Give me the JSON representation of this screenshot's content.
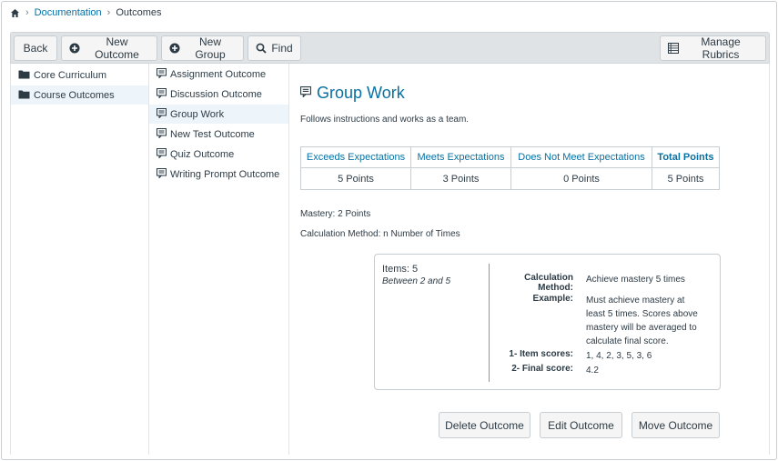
{
  "breadcrumb": {
    "home_icon": "home-icon",
    "items": [
      "Documentation",
      "Outcomes"
    ]
  },
  "toolbar": {
    "back": "Back",
    "new_outcome": "New Outcome",
    "new_group": "New Group",
    "find": "Find",
    "manage_rubrics": "Manage Rubrics"
  },
  "groups": [
    {
      "label": "Core Curriculum",
      "icon": "folder-icon"
    },
    {
      "label": "Course Outcomes",
      "icon": "folder-icon",
      "selected": true
    }
  ],
  "outcomes": [
    {
      "label": "Assignment Outcome",
      "icon": "outcome-icon"
    },
    {
      "label": "Discussion Outcome",
      "icon": "outcome-icon"
    },
    {
      "label": "Group Work",
      "icon": "outcome-icon",
      "selected": true
    },
    {
      "label": "New Test Outcome",
      "icon": "outcome-icon"
    },
    {
      "label": "Quiz Outcome",
      "icon": "outcome-icon"
    },
    {
      "label": "Writing Prompt Outcome",
      "icon": "outcome-icon"
    }
  ],
  "detail": {
    "title": "Group Work",
    "description": "Follows instructions and works as a team.",
    "ratings": [
      {
        "label": "Exceeds Expectations",
        "points": "5 Points"
      },
      {
        "label": "Meets Expectations",
        "points": "3 Points"
      },
      {
        "label": "Does Not Meet Expectations",
        "points": "0 Points"
      }
    ],
    "total": {
      "label": "Total Points",
      "points": "5 Points"
    },
    "mastery": "Mastery: 2 Points",
    "calculation": "Calculation Method: n Number of Times",
    "calc_box": {
      "items_label": "Items:",
      "items_value": "5",
      "between": "Between 2 and 5",
      "method_label": "Calculation Method:",
      "method_value": "Achieve mastery 5 times",
      "example_label": "Example:",
      "example_value": "Must achieve mastery at least 5 times. Scores above mastery will be averaged to calculate final score.",
      "item_scores_label": "1- Item scores:",
      "item_scores_value": "1, 4, 2, 3, 5, 3, 6",
      "final_score_label": "2- Final score:",
      "final_score_value": "4.2"
    },
    "buttons": {
      "delete": "Delete Outcome",
      "edit": "Edit Outcome",
      "move": "Move Outcome"
    }
  },
  "colors": {
    "link": "#0770a3",
    "toolbar_bg": "#dfe3e6",
    "selected_bg": "#eef5fa"
  }
}
